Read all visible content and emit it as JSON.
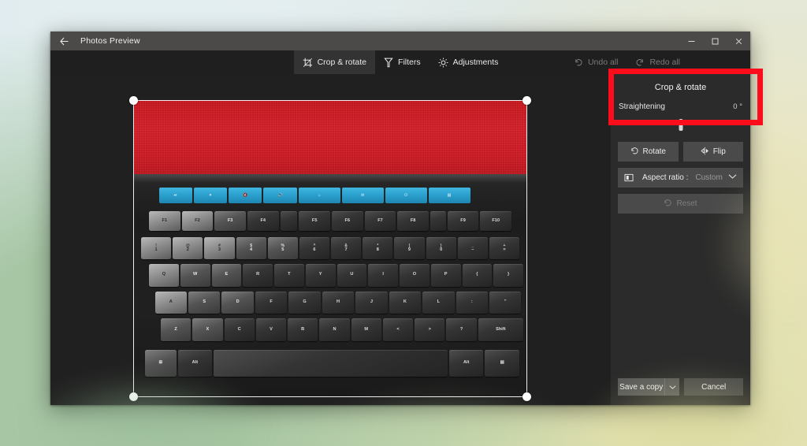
{
  "window": {
    "title": "Photos Preview",
    "back_icon": "back-arrow-icon",
    "controls": {
      "minimize": "minimize-icon",
      "maximize": "maximize-icon",
      "close": "close-icon"
    }
  },
  "toolbar": {
    "tabs": [
      {
        "label": "Crop & rotate",
        "icon": "crop-rotate-icon",
        "active": true
      },
      {
        "label": "Filters",
        "icon": "filters-icon",
        "active": false
      },
      {
        "label": "Adjustments",
        "icon": "adjustments-icon",
        "active": false
      }
    ],
    "undo_all": "Undo all",
    "redo_all": "Redo all",
    "undo_icon": "undo-icon",
    "redo_icon": "redo-icon"
  },
  "panel": {
    "title": "Crop & rotate",
    "straightening_label": "Straightening",
    "straightening_value": "0 °",
    "slider_position_pct": 50,
    "rotate_label": "Rotate",
    "rotate_icon": "rotate-icon",
    "flip_label": "Flip",
    "flip_icon": "flip-icon",
    "aspect_ratio_label": "Aspect ratio :",
    "aspect_ratio_value": "Custom",
    "aspect_ratio_icon": "aspect-ratio-icon",
    "chevron_icon": "chevron-down-icon",
    "reset_label": "Reset",
    "reset_icon": "reset-icon",
    "save_label": "Save a copy",
    "save_caret_icon": "chevron-down-icon",
    "cancel_label": "Cancel"
  },
  "annotation": {
    "color": "#fc0d1c",
    "shape": "rectangle"
  },
  "photo": {
    "subject": "computer keyboard on red cloth",
    "media_keys": [
      "⏯",
      "✦",
      "🔇",
      "🔊",
      "⌂",
      "✉",
      "⏻",
      "▤"
    ],
    "function_keys": [
      "F1",
      "F2",
      "F3",
      "F4",
      "F5",
      "F6",
      "F7",
      "F8",
      "F9",
      "F10"
    ],
    "number_row": [
      {
        "top": "!",
        "bottom": "1"
      },
      {
        "top": "@",
        "bottom": "2"
      },
      {
        "top": "#",
        "bottom": "3"
      },
      {
        "top": "$",
        "bottom": "4"
      },
      {
        "top": "%",
        "bottom": "5"
      },
      {
        "top": "^",
        "bottom": "6"
      },
      {
        "top": "&",
        "bottom": "7"
      },
      {
        "top": "*",
        "bottom": "8"
      },
      {
        "top": "(",
        "bottom": "9"
      },
      {
        "top": ")",
        "bottom": "0"
      },
      {
        "top": "_",
        "bottom": "–"
      },
      {
        "top": "+",
        "bottom": "="
      }
    ],
    "qwerty_row": [
      "Q",
      "W",
      "E",
      "R",
      "T",
      "Y",
      "U",
      "I",
      "O",
      "P",
      "{",
      "}"
    ],
    "home_row": [
      "A",
      "S",
      "D",
      "F",
      "G",
      "H",
      "J",
      "K",
      "L",
      ":",
      "\""
    ],
    "bottom_row": [
      "Z",
      "X",
      "C",
      "V",
      "B",
      "N",
      "M",
      "<",
      ">",
      "?",
      "Shift"
    ],
    "space_row": [
      "⊞",
      "Alt",
      "",
      "Alt",
      "▤"
    ]
  },
  "crop": {
    "handles": [
      "top-left",
      "top-right",
      "bottom-left",
      "bottom-right"
    ]
  }
}
